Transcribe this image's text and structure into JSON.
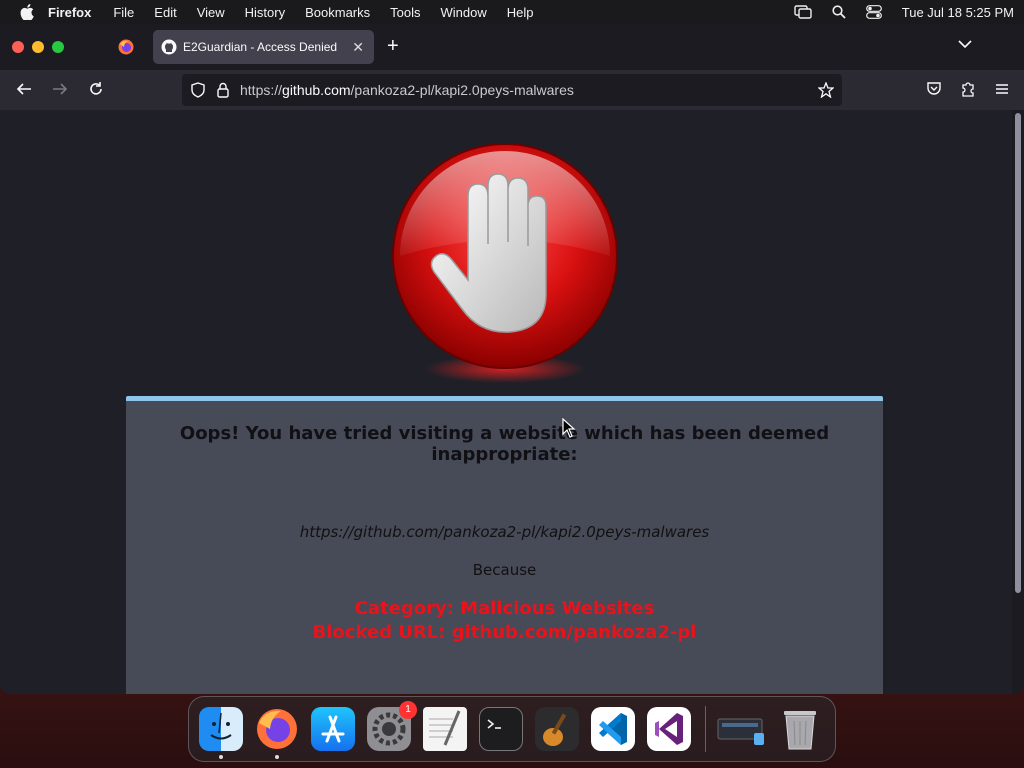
{
  "menubar": {
    "app_name": "Firefox",
    "menus": [
      "File",
      "Edit",
      "View",
      "History",
      "Bookmarks",
      "Tools",
      "Window",
      "Help"
    ],
    "datetime": "Tue Jul 18  5:25 PM"
  },
  "browser": {
    "tab_title": "E2Guardian - Access Denied",
    "url_prefix": "https://",
    "url_host": "github.com",
    "url_path": "/pankoza2-pl/kapi2.0peys-malwares"
  },
  "page": {
    "headline": "Oops! You have tried visiting a website which has been deemed inappropriate:",
    "blocked_url": "https://github.com/pankoza2-pl/kapi2.0peys-malwares",
    "because": "Because",
    "category": "Category: Malicious Websites",
    "blocked_url_reason": "Blocked URL: github.com/pankoza2-pl"
  },
  "dock": {
    "apps": [
      "finder-icon",
      "firefox-icon",
      "app-store-icon",
      "system-settings-icon",
      "textedit-icon",
      "terminal-icon",
      "garageband-icon",
      "vscode-icon",
      "visual-studio-icon"
    ],
    "settings_badge": "1"
  },
  "colors": {
    "accent_blue": "#8ec5ea",
    "reason_red": "#e8131b",
    "panel_bg": "#474a57"
  }
}
